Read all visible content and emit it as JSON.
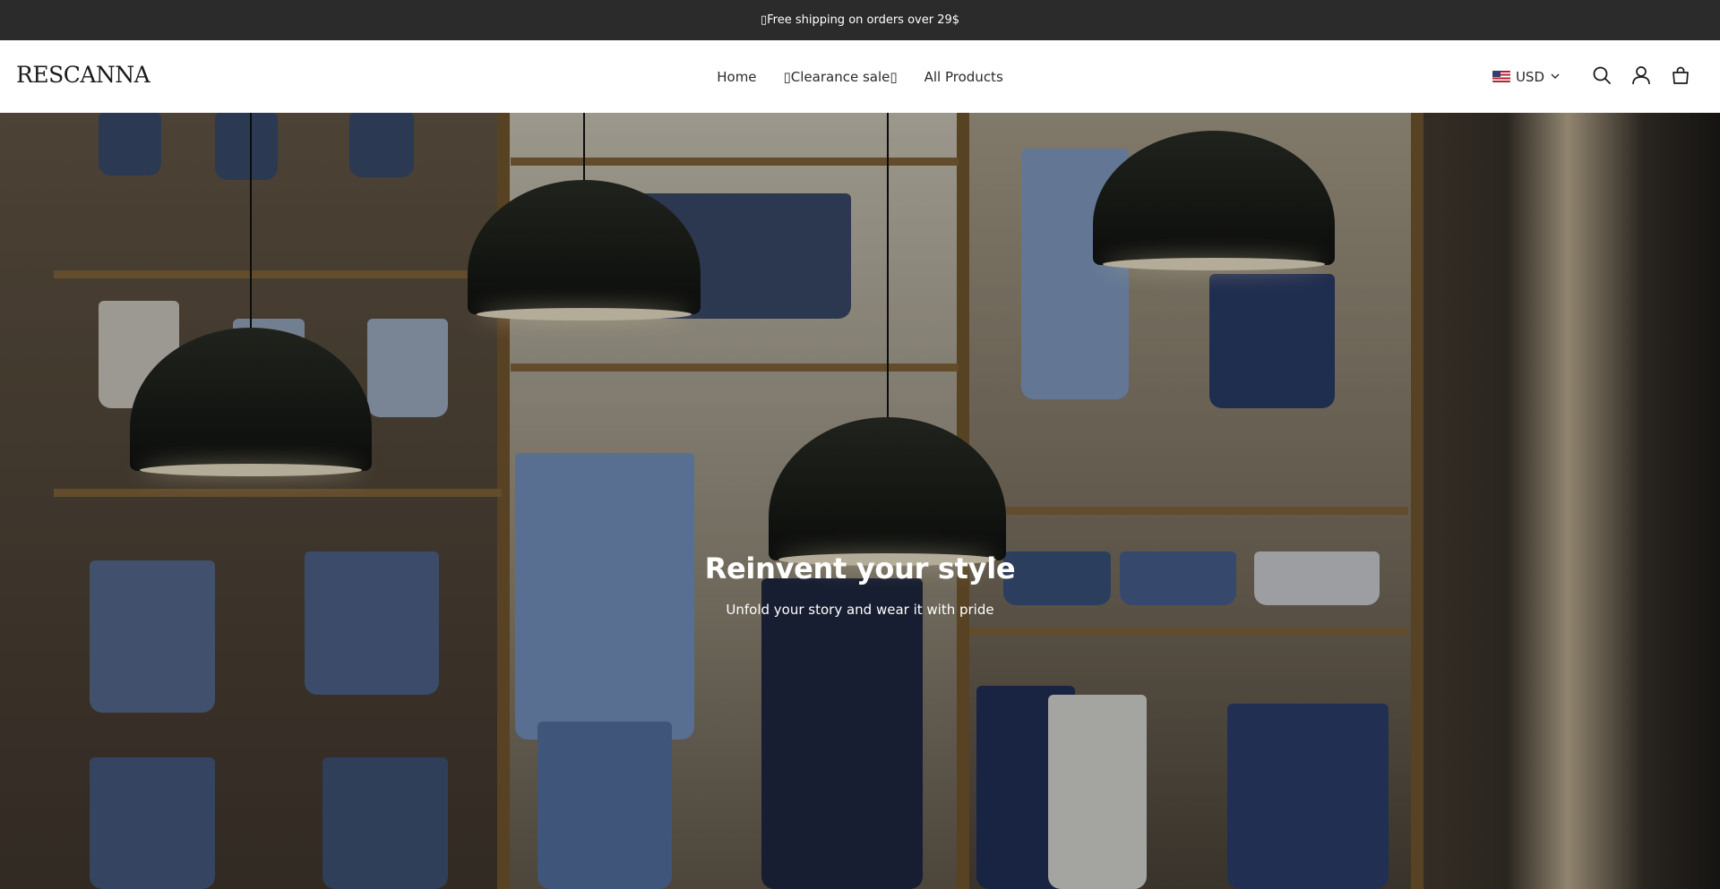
{
  "announcement": {
    "text": "▯Free shipping on orders over 29$"
  },
  "header": {
    "logo": "RESCANNA",
    "nav": [
      {
        "label": "Home"
      },
      {
        "label": "▯Clearance sale▯"
      },
      {
        "label": "All Products"
      }
    ],
    "currency": {
      "flag": "us-flag-icon",
      "code": "USD"
    },
    "icons": [
      "search-icon",
      "account-icon",
      "cart-icon"
    ]
  },
  "hero": {
    "title": "Reinvent your style",
    "subtitle": "Unfold your story and wear it with pride"
  },
  "colors": {
    "announcement_bg": "#2b2b2b",
    "header_bg": "#ffffff",
    "text_dark": "#2a2a2a",
    "hero_text": "#ffffff"
  }
}
